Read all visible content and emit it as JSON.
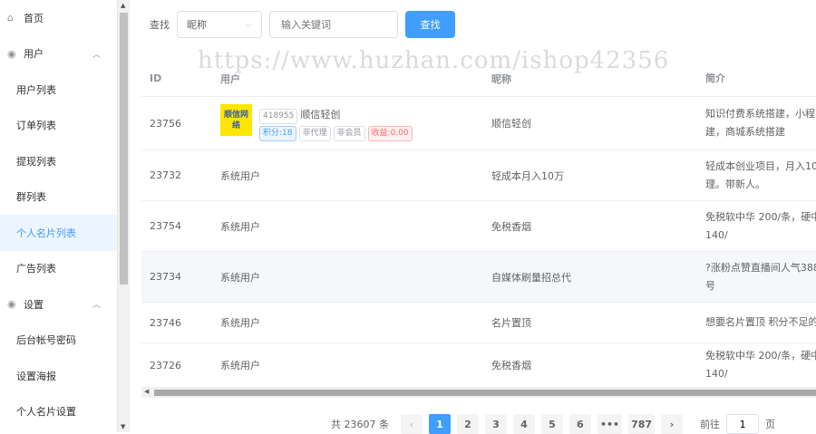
{
  "sidebar": {
    "items": [
      {
        "label": "首页",
        "type": "group",
        "icon": "home-icon"
      },
      {
        "label": "用户",
        "type": "group",
        "icon": "location-icon",
        "expanded": true
      },
      {
        "label": "用户列表"
      },
      {
        "label": "订单列表"
      },
      {
        "label": "提现列表"
      },
      {
        "label": "群列表"
      },
      {
        "label": "个人名片列表",
        "active": true
      },
      {
        "label": "广告列表"
      },
      {
        "label": "设置",
        "type": "group",
        "icon": "location-icon",
        "expanded": true
      },
      {
        "label": "后台帐号密码"
      },
      {
        "label": "设置海报"
      },
      {
        "label": "个人名片设置"
      }
    ]
  },
  "search": {
    "label": "查找",
    "select_value": "昵称",
    "placeholder": "输入关键词",
    "button": "查找"
  },
  "table": {
    "headers": [
      "ID",
      "用户",
      "昵称",
      "简介"
    ],
    "rows": [
      {
        "id": "23756",
        "user": "",
        "nickname": "顺信轻创",
        "intro": [
          "知识付费系统搭建，小程",
          "建，商城系统搭建"
        ],
        "avatar_text": "顺信网络",
        "uid": "418955",
        "name": "顺信轻创",
        "tags": [
          "积分:18",
          "非代理",
          "非会员",
          "收益:0.00"
        ]
      },
      {
        "id": "23732",
        "user": "系统用户",
        "nickname": "轻成本月入10万",
        "intro": [
          "轻成本创业项目，月入10",
          "理。带新人。"
        ]
      },
      {
        "id": "23754",
        "user": "系统用户",
        "nickname": "免税香烟",
        "intro": [
          "免税软中华 200/条，硬中",
          "140/"
        ]
      },
      {
        "id": "23734",
        "user": "系统用户",
        "nickname": "自媒体刷量招总代",
        "intro": [
          "?涨粉点赞直播间人气388",
          "号"
        ]
      },
      {
        "id": "23746",
        "user": "系统用户",
        "nickname": "名片置顶",
        "intro": [
          "想要名片置顶 积分不足的"
        ]
      },
      {
        "id": "23726",
        "user": "系统用户",
        "nickname": "免税香烟",
        "intro": [
          "免税软中华 200/条，硬中",
          "140/"
        ]
      }
    ]
  },
  "pagination": {
    "total": "共 23607 条",
    "pages": [
      "1",
      "2",
      "3",
      "4",
      "5",
      "6",
      "•••",
      "787"
    ],
    "current": "1",
    "goto_label": "前往",
    "goto_value": "1",
    "page_suffix": "页"
  },
  "watermark": "https://www.huzhan.com/ishop42356"
}
